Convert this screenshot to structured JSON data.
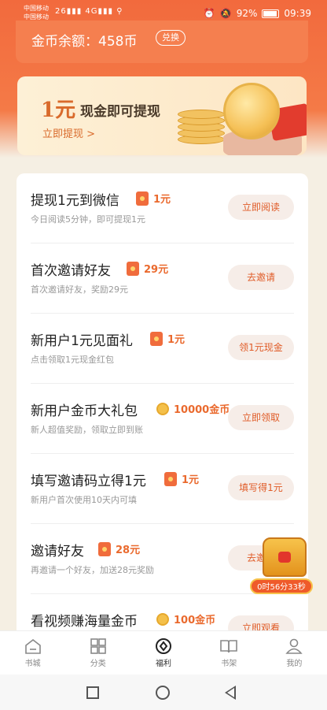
{
  "status_bar": {
    "carrier_1": "中国移动",
    "carrier_2": "中国移动",
    "signal_1": "26",
    "signal_2": "4G",
    "battery": "92%",
    "time": "09:39"
  },
  "coins": {
    "label": "金币余额：458币",
    "exchange_label": "兑换"
  },
  "banner": {
    "amount": "1元",
    "text": "现金即可提现",
    "link": "立即提现 >"
  },
  "tasks": [
    {
      "title": "提现1元到微信",
      "reward": "1元",
      "reward_type": "red-envelope",
      "subtitle": "今日阅读5分钟，即可提现1元",
      "button": "立即阅读"
    },
    {
      "title": "首次邀请好友",
      "reward": "29元",
      "reward_type": "red-envelope",
      "subtitle": "首次邀请好友，奖励29元",
      "button": "去邀请"
    },
    {
      "title": "新用户1元见面礼",
      "reward": "1元",
      "reward_type": "red-envelope",
      "subtitle": "点击领取1元现金红包",
      "button": "领1元现金"
    },
    {
      "title": "新用户金币大礼包",
      "reward": "10000金币",
      "reward_type": "coin",
      "subtitle": "新人超值奖励，领取立即到账",
      "button": "立即领取"
    },
    {
      "title": "填写邀请码立得1元",
      "reward": "1元",
      "reward_type": "red-envelope",
      "subtitle": "新用户首次使用10天内可填",
      "button": "填写得1元"
    },
    {
      "title": "邀请好友",
      "reward": "28元",
      "reward_type": "red-envelope",
      "subtitle": "再邀请一个好友，加送28元奖励",
      "button": "去邀请"
    },
    {
      "title": "看视频赚海量金币",
      "reward": "100金币",
      "reward_type": "coin",
      "subtitle": "",
      "button": "立即观看"
    }
  ],
  "floating_chest": {
    "timer": "0时56分33秒"
  },
  "tabbar": [
    {
      "label": "书城",
      "icon": "home-icon"
    },
    {
      "label": "分类",
      "icon": "grid-icon"
    },
    {
      "label": "福利",
      "icon": "gift-icon"
    },
    {
      "label": "书架",
      "icon": "book-icon"
    },
    {
      "label": "我的",
      "icon": "person-icon"
    }
  ],
  "colors": {
    "accent": "#f26a3d",
    "reward": "#ea6a2e"
  }
}
